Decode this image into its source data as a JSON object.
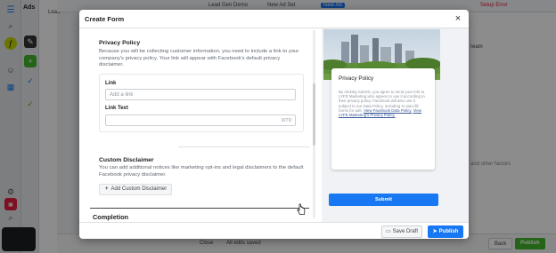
{
  "background": {
    "sidebar_title": "Ads",
    "tree_item": "Lead",
    "breadcrumbs": [
      "Lead Gen Demo",
      "New Ad Set",
      "New Ad"
    ],
    "setup_error": "Setup Error",
    "right_panel_snippet": "ream",
    "right_panel_snippet2": "and other factors",
    "bottom": {
      "close_label": "Close",
      "saved_label": "All edits saved",
      "back_label": "Back",
      "publish_label": "Publish"
    }
  },
  "modal": {
    "title": "Create Form",
    "close_glyph": "×",
    "privacy": {
      "heading": "Privacy Policy",
      "description": "Because you will be collecting customer information, you need to include a link to your company's privacy policy. Your link will appear with Facebook's default privacy disclaimer.",
      "link_label": "Link",
      "link_placeholder": "Add a link",
      "link_text_label": "Link Text",
      "link_text_count": "0/70"
    },
    "disclaimer": {
      "heading": "Custom Disclaimer",
      "description": "You can add additional notices like marketing opt-ins and legal disclaimers to the default Facebook privacy disclaimer.",
      "add_button": "Add Custom Disclaimer",
      "plus_glyph": "+"
    },
    "completion_label": "Completion",
    "preview": {
      "card_title": "Privacy Policy",
      "body_text": "By clicking Submit, you agree to send your info to LYFE Marketing who agrees to use it according to their privacy policy. Facebook will also use it subject to our Data Policy, including to auto-fill forms for ads.",
      "link1": "View Facebook Data Policy.",
      "link2": "View LYFE Marketing's Privacy Policy.",
      "submit_label": "Submit"
    },
    "footer": {
      "save_draft": "Save Draft",
      "publish": "Publish"
    }
  },
  "colors": {
    "accent": "#1877f2",
    "publish_green": "#42b72a"
  }
}
